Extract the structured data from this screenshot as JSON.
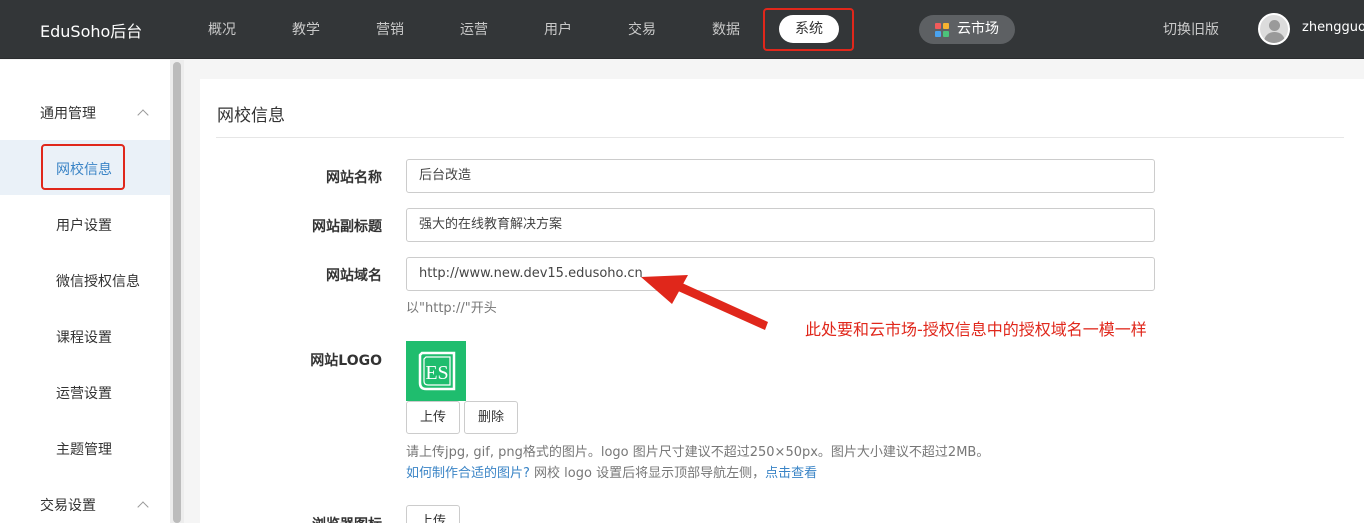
{
  "topbar": {
    "brand": "EduSoho后台",
    "nav": [
      "概况",
      "教学",
      "营销",
      "运营",
      "用户",
      "交易",
      "数据"
    ],
    "nav_active": "系统",
    "cloud_market": "云市场",
    "switch_old": "切换旧版",
    "username": "zhengguo"
  },
  "sidebar": {
    "group1": "通用管理",
    "items": [
      "网校信息",
      "用户设置",
      "微信授权信息",
      "课程设置",
      "运营设置",
      "主题管理"
    ],
    "group2": "交易设置"
  },
  "main": {
    "title": "网校信息",
    "fields": {
      "site_name_label": "网站名称",
      "site_name_value": "后台改造",
      "site_subtitle_label": "网站副标题",
      "site_subtitle_value": "强大的在线教育解决方案",
      "site_domain_label": "网站域名",
      "site_domain_value": "http://www.new.dev15.edusoho.cn",
      "site_domain_hint": "以\"http://\"开头",
      "logo_label": "网站LOGO",
      "logo_mark": "ES",
      "upload_button": "上传",
      "delete_button": "删除",
      "logo_hint": "请上传jpg, gif, png格式的图片。logo 图片尺寸建议不超过250×50px。图片大小建议不超过2MB。",
      "logo_help_link": "如何制作合适的图片?",
      "logo_help_text": " 网校 logo 设置后将显示顶部导航左侧，",
      "logo_view_link": "点击查看",
      "favicon_label": "浏览器图标",
      "favicon_upload_button": "上传"
    },
    "annotation": "此处要和云市场-授权信息中的授权域名一模一样"
  },
  "colors": {
    "topbar_bg": "#333638",
    "highlight_red": "#e0271b",
    "link_blue": "#3a84c6",
    "logo_green": "#1fbd6e"
  }
}
